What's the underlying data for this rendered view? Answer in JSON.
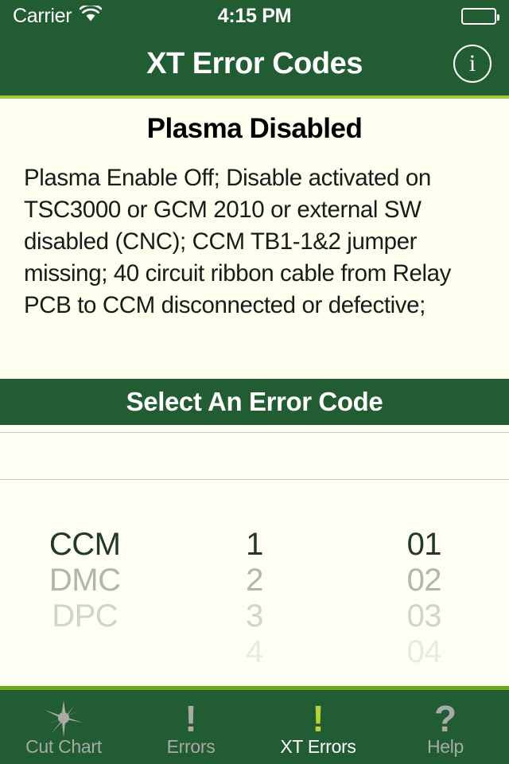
{
  "status_bar": {
    "carrier": "Carrier",
    "wifi_icon": "wifi-icon",
    "time": "4:15 PM",
    "battery_icon": "battery-icon"
  },
  "nav_bar": {
    "title": "XT Error Codes",
    "info_icon_label": "i",
    "background": "#225c33",
    "accent_line": "#a8c63c"
  },
  "content": {
    "error_title": "Plasma Disabled",
    "error_description": "Plasma Enable Off; Disable activated on TSC3000 or GCM 2010 or external SW disabled (CNC);  CCM TB1-1&2 jumper missing; 40 circuit ribbon cable from Relay PCB to CCM disconnected or defective;"
  },
  "section_bar": {
    "title": "Select An Error Code"
  },
  "picker": {
    "columns": [
      {
        "name": "module-column",
        "selected": "CCM",
        "options": [
          "CCM",
          "DMC",
          "DPC"
        ]
      },
      {
        "name": "group-column",
        "selected": "1",
        "options": [
          "1",
          "2",
          "3",
          "4"
        ]
      },
      {
        "name": "code-column",
        "selected": "01",
        "options": [
          "01",
          "02",
          "03",
          "04"
        ]
      }
    ]
  },
  "tab_bar": {
    "items": [
      {
        "label": "Cut Chart",
        "icon": "star-icon",
        "active": false
      },
      {
        "label": "Errors",
        "icon": "exclamation-icon",
        "active": false
      },
      {
        "label": "XT Errors",
        "icon": "exclamation-icon",
        "active": true
      },
      {
        "label": "Help",
        "icon": "question-mark-icon",
        "active": false
      }
    ],
    "active_color": "#b5d334",
    "inactive_color": "#a9aaa6",
    "background": "#225c33",
    "top_line": "#6aa81e"
  }
}
